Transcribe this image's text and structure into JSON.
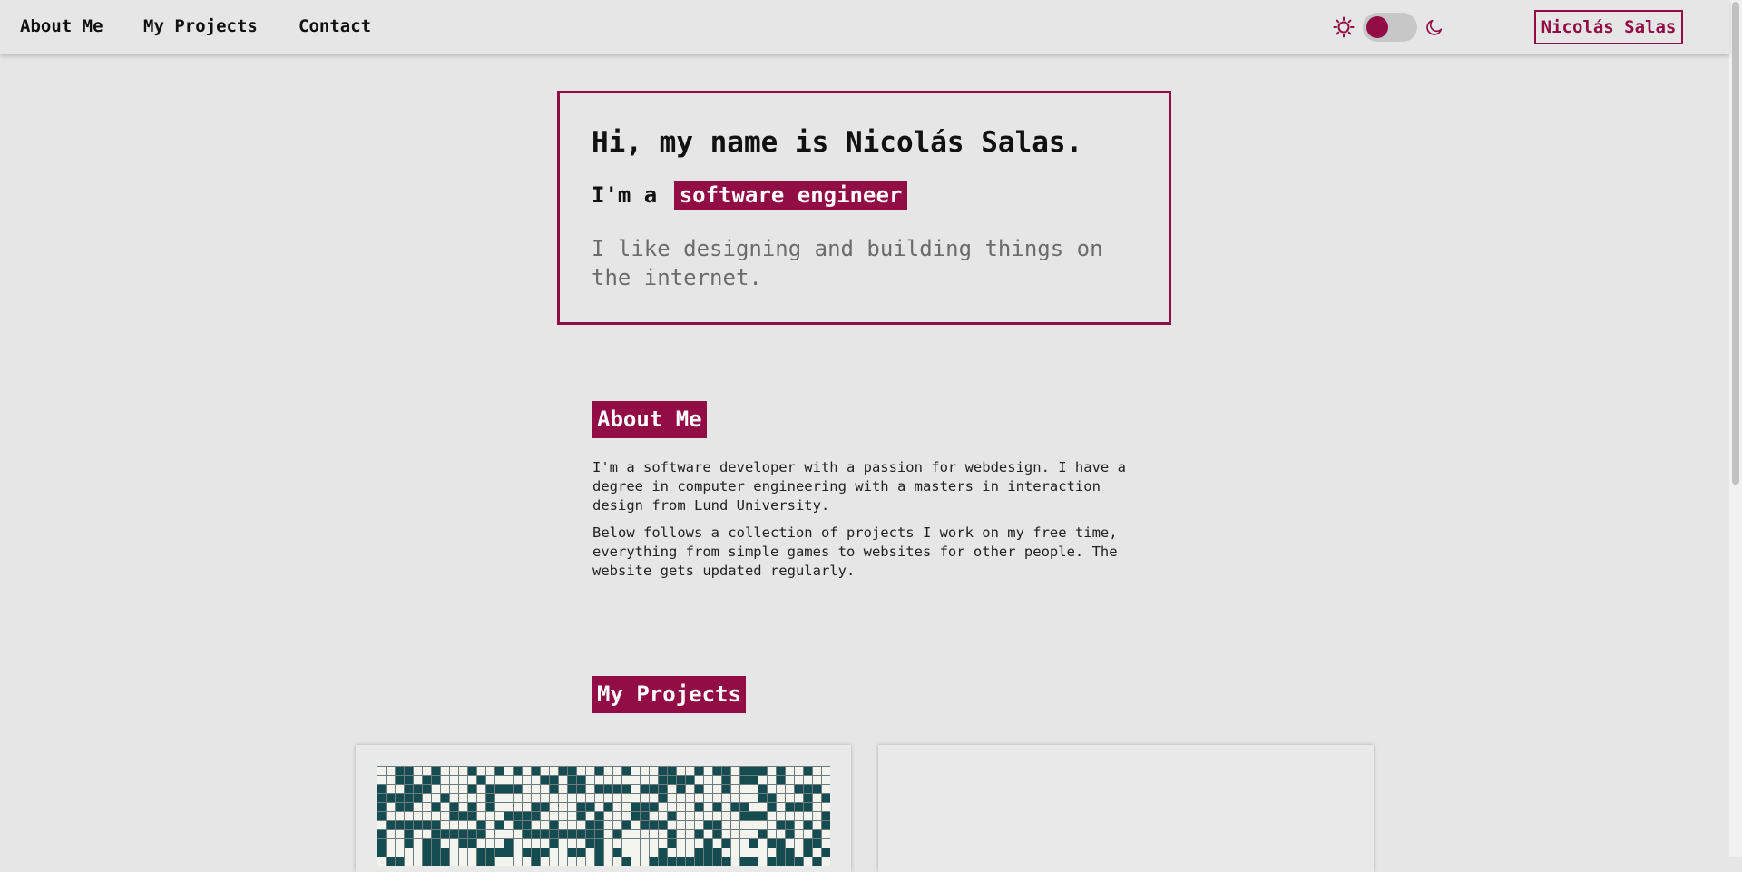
{
  "nav": {
    "links": [
      "About Me",
      "My Projects",
      "Contact"
    ],
    "brand": "Nicolás Salas",
    "accent_color": "#920d45",
    "theme_toggle": {
      "left_icon": "sun-icon",
      "right_icon": "moon-icon"
    }
  },
  "hero": {
    "title": "Hi, my name is Nicolás Salas.",
    "role_prefix": "I'm a",
    "role": "software engineer",
    "description": "I like designing and building things on the internet."
  },
  "about": {
    "heading": "About Me",
    "paragraphs": [
      "I'm a software developer with a passion for webdesign. I have a degree in computer engineering with a masters in interaction design from Lund University.",
      "Below follows a collection of projects I work on my free time, everything from simple games to websites for other people. The website gets updated regularly."
    ]
  },
  "projects": {
    "heading": "My Projects",
    "grid_fill_color": "#144c52"
  }
}
